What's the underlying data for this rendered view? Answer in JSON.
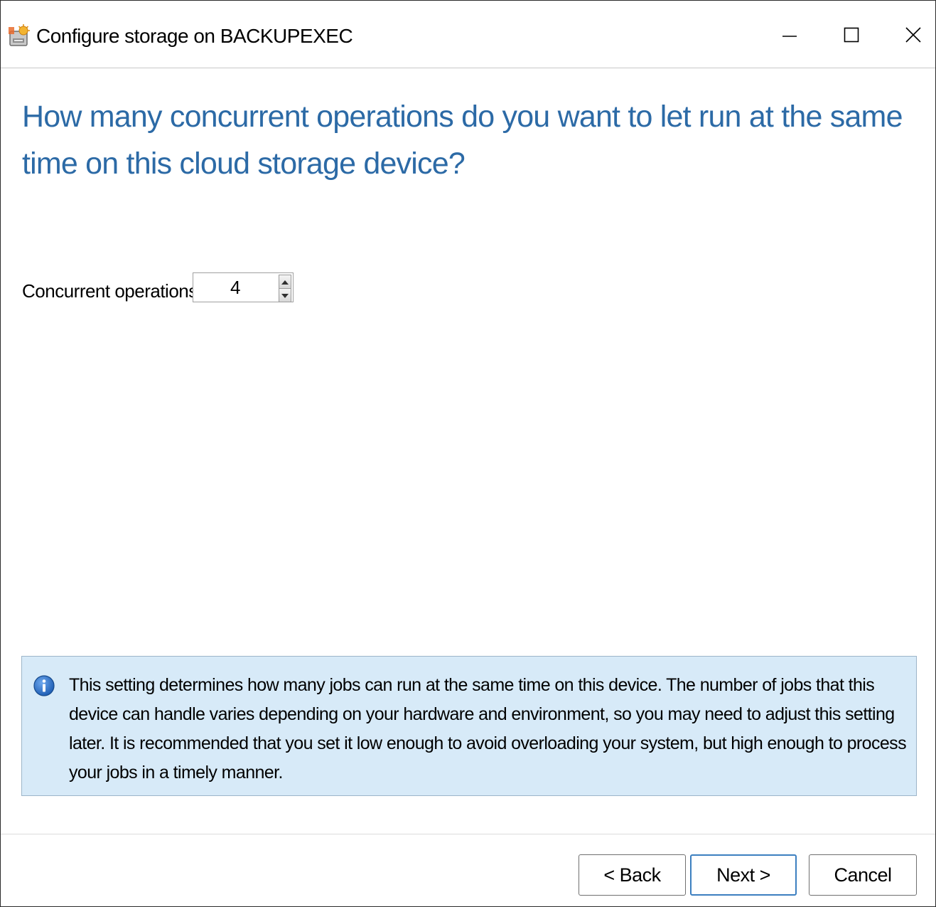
{
  "window": {
    "title": "Configure storage on BACKUPEXEC",
    "controls": {
      "minimize_icon": "minimize-icon",
      "maximize_icon": "maximize-icon",
      "close_icon": "close-icon"
    }
  },
  "main": {
    "heading": "How many concurrent operations do you want to let run at the same time on this cloud storage device?",
    "concurrent_label": "Concurrent operations:",
    "concurrent_value": "4"
  },
  "info": {
    "icon": "info-icon",
    "text": "This setting determines how many jobs can run at the same time on this device. The number of jobs that this device can handle varies depending on your hardware and environment, so you may need to adjust this setting later. It is recommended that you set it low enough to avoid overloading your system, but high enough to process your jobs in a timely manner."
  },
  "footer": {
    "back_label": "< Back",
    "next_label": "Next >",
    "cancel_label": "Cancel"
  },
  "colors": {
    "heading": "#2c6aa6",
    "info_background": "#d7eaf8",
    "info_icon": "#1f5fb5",
    "default_button_border": "#3c7fc0"
  }
}
